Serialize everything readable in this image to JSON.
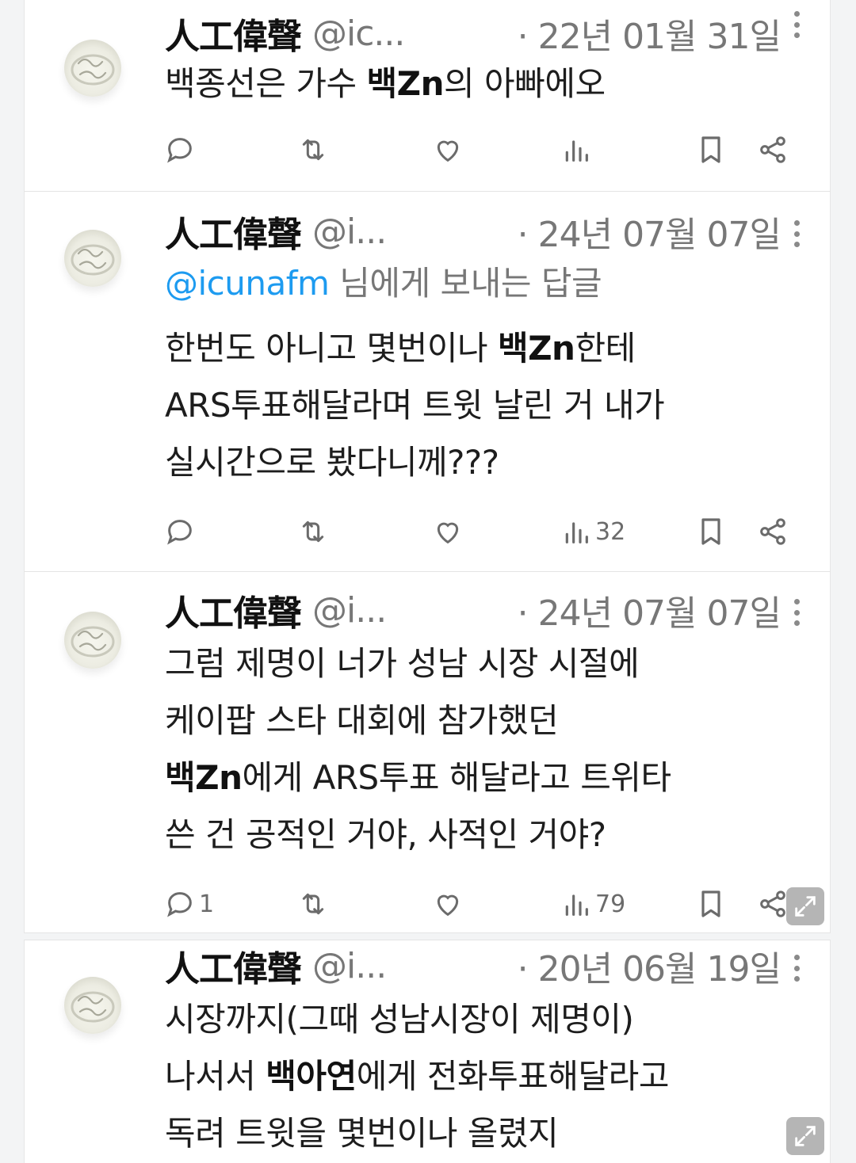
{
  "tweets": [
    {
      "name": "人工偉聲",
      "handle": "@ic...",
      "date": "· 22년 01월 31일",
      "lines": [
        [
          {
            "t": "백종선은 가수 "
          },
          {
            "t": "백Zn",
            "b": true
          },
          {
            "t": "의 아빠에오"
          }
        ]
      ],
      "reply_count": "",
      "view_count": ""
    },
    {
      "name": "人工偉聲",
      "handle": "@i...",
      "date": "· 24년 07월 07일",
      "reply_to": {
        "mention": "@icunafm",
        "suffix": " 님에게 보내는 답글"
      },
      "lines": [
        [
          {
            "t": "한번도 아니고 몇번이나 "
          },
          {
            "t": "백Zn",
            "b": true
          },
          {
            "t": "한테"
          }
        ],
        [
          {
            "t": "ARS투표해달라며 트윗 날린 거 내가"
          }
        ],
        [
          {
            "t": "실시간으로 봤다니께???"
          }
        ]
      ],
      "reply_count": "",
      "view_count": "32"
    },
    {
      "name": "人工偉聲",
      "handle": "@i...",
      "date": "· 24년 07월 07일",
      "lines": [
        [
          {
            "t": "그럼 제명이 너가 성남 시장 시절에"
          }
        ],
        [
          {
            "t": "케이팝 스타 대회에 참가했던"
          }
        ],
        [
          {
            "t": "백Zn",
            "b": true
          },
          {
            "t": "에게  ARS투표 해달라고 트위타"
          }
        ],
        [
          {
            "t": "쓴 건 공적인 거야, 사적인 거야?"
          }
        ]
      ],
      "reply_count": "1",
      "view_count": "79"
    },
    {
      "name": "人工偉聲",
      "handle": "@i...",
      "date": "· 20년 06월 19일",
      "lines": [
        [
          {
            "t": "시장까지(그때 성남시장이 제명이)"
          }
        ],
        [
          {
            "t": "나서서 "
          },
          {
            "t": "백아연",
            "b": true
          },
          {
            "t": "에게 전화투표해달라고"
          }
        ],
        [
          {
            "t": "독려 트윗을 몇번이나 올렸지"
          }
        ]
      ],
      "reply_count": "",
      "view_count": ""
    }
  ],
  "icons": {
    "reply": "reply-icon",
    "retweet": "retweet-icon",
    "like": "heart-icon",
    "views": "views-icon",
    "bookmark": "bookmark-icon",
    "share": "share-icon",
    "more": "more-icon",
    "expand": "expand-icon"
  },
  "colors": {
    "mention": "#1d9bf0",
    "secondary_text": "#777777",
    "background": "#f3f4f5"
  }
}
